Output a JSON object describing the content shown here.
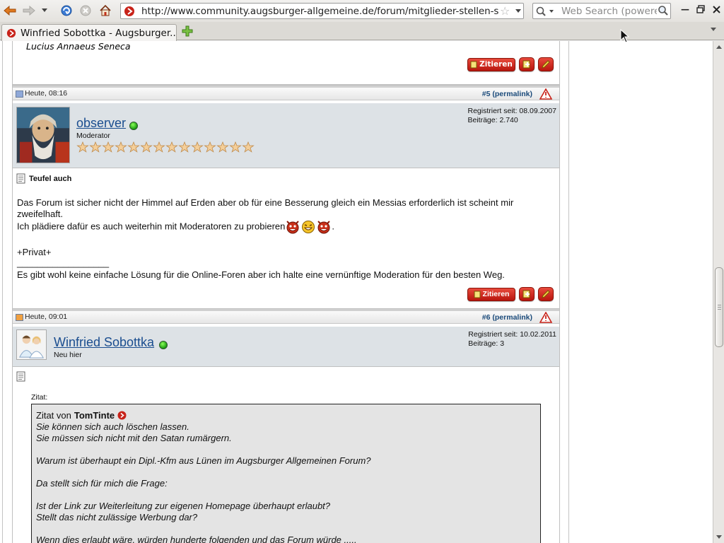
{
  "browser": {
    "url": "http://www.community.augsburger-allgemeine.de/forum/mitglieder-stellen-sic",
    "search_placeholder": "Web Search (powered",
    "tab_title": "Winfried Sobottka - Augsburger..."
  },
  "previous_post": {
    "quote_author_line": "Lucius Annaeus Seneca",
    "quote_button": "Zitieren"
  },
  "post5": {
    "date": "Heute, 08:16",
    "number": "#5",
    "permalink": "(permalink)",
    "username": "observer",
    "rank": "Moderator",
    "registered": "Registriert seit: 08.09.2007",
    "posts": "Beiträge: 2.740",
    "stars_count": 14,
    "title": "Teufel auch",
    "line1": "Das Forum ist sicher nicht der Himmel auf Erden aber ob für eine Besserung gleich ein Messias erforderlich ist scheint mir",
    "line2": "zweifelhaft.",
    "line3": "Ich plädiere dafür es auch weiterhin mit Moderatoren zu probieren",
    "line3_end": ".",
    "privat": "+Privat+",
    "signature_rule": "__________________",
    "signature": "Es gibt wohl keine einfache Lösung für die Online-Foren aber ich halte eine vernünftige Moderation für den besten Weg.",
    "quote_button": "Zitieren"
  },
  "post6": {
    "date": "Heute, 09:01",
    "number": "#6",
    "permalink": "(permalink)",
    "username": "Winfried Sobottka",
    "rank": "Neu hier",
    "registered": "Registriert seit: 10.02.2011",
    "posts": "Beiträge: 3",
    "quote_label": "Zitat:",
    "quote_prefix": "Zitat von",
    "quote_author": "TomTinte",
    "quote_lines": [
      "Sie können sich auch löschen lassen.",
      "Sie müssen sich nicht mit den Satan rumärgern.",
      "Warum ist überhaupt ein Dipl.-Kfm aus Lünen im Augsburger Allgemeinen Forum?",
      "Da stellt sich für mich die Frage:",
      "Ist der Link zur Weiterleitung zur eigenen Homepage überhaupt erlaubt?",
      "Stellt das nicht zulässige Werbung dar?",
      "Wenn dies erlaubt wäre, würden hunderte folgenden und das Forum würde ....."
    ]
  },
  "colors": {
    "button_red": "#c8231a",
    "link_blue": "#1a4d8f",
    "user_panel_bg": "#dde2e6",
    "quote_bg": "#e4e4e4"
  }
}
